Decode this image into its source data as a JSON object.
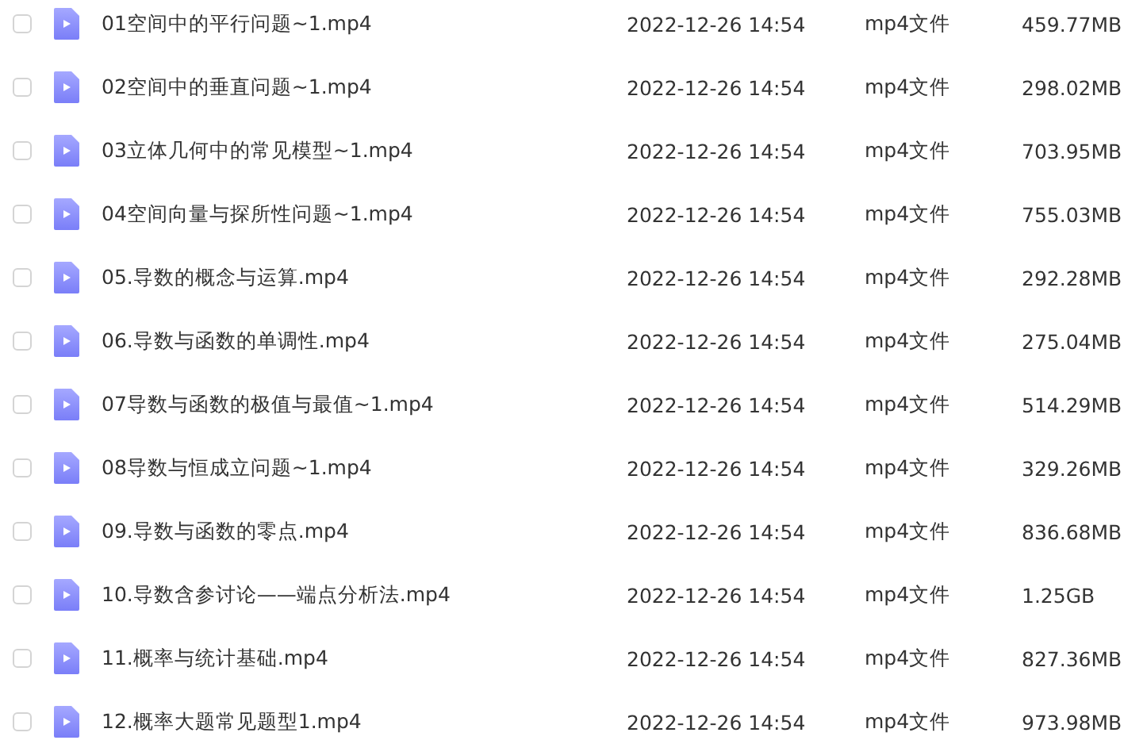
{
  "files": [
    {
      "name": "01空间中的平行问题~1.mp4",
      "modified": "2022-12-26 14:54",
      "type": "mp4文件",
      "size": "459.77MB",
      "checked": false
    },
    {
      "name": "02空间中的垂直问题~1.mp4",
      "modified": "2022-12-26 14:54",
      "type": "mp4文件",
      "size": "298.02MB",
      "checked": false
    },
    {
      "name": "03立体几何中的常见模型~1.mp4",
      "modified": "2022-12-26 14:54",
      "type": "mp4文件",
      "size": "703.95MB",
      "checked": false
    },
    {
      "name": "04空间向量与探所性问题~1.mp4",
      "modified": "2022-12-26 14:54",
      "type": "mp4文件",
      "size": "755.03MB",
      "checked": false
    },
    {
      "name": "05.导数的概念与运算.mp4",
      "modified": "2022-12-26 14:54",
      "type": "mp4文件",
      "size": "292.28MB",
      "checked": false
    },
    {
      "name": "06.导数与函数的单调性.mp4",
      "modified": "2022-12-26 14:54",
      "type": "mp4文件",
      "size": "275.04MB",
      "checked": false
    },
    {
      "name": "07导数与函数的极值与最值~1.mp4",
      "modified": "2022-12-26 14:54",
      "type": "mp4文件",
      "size": "514.29MB",
      "checked": false
    },
    {
      "name": "08导数与恒成立问题~1.mp4",
      "modified": "2022-12-26 14:54",
      "type": "mp4文件",
      "size": "329.26MB",
      "checked": false
    },
    {
      "name": "09.导数与函数的零点.mp4",
      "modified": "2022-12-26 14:54",
      "type": "mp4文件",
      "size": "836.68MB",
      "checked": false
    },
    {
      "name": "10.导数含参讨论——端点分析法.mp4",
      "modified": "2022-12-26 14:54",
      "type": "mp4文件",
      "size": "1.25GB",
      "checked": false
    },
    {
      "name": "11.概率与统计基础.mp4",
      "modified": "2022-12-26 14:54",
      "type": "mp4文件",
      "size": "827.36MB",
      "checked": false
    },
    {
      "name": "12.概率大题常见题型1.mp4",
      "modified": "2022-12-26 14:54",
      "type": "mp4文件",
      "size": "973.98MB",
      "checked": false
    }
  ]
}
